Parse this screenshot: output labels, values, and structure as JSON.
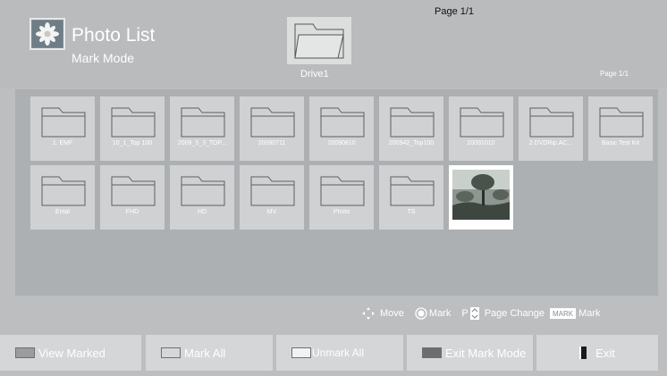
{
  "header": {
    "title": "Photo List",
    "subtitle": "Mark Mode",
    "top_page": "Page 1/1",
    "drive_label": "Drive1",
    "right_page": "Page 1/1"
  },
  "items": [
    {
      "type": "folder",
      "name": "1. EMF"
    },
    {
      "type": "folder",
      "name": "10_1_Top 100"
    },
    {
      "type": "folder",
      "name": "2009_5_3_TOP..."
    },
    {
      "type": "folder",
      "name": "20090711"
    },
    {
      "type": "folder",
      "name": "20090810"
    },
    {
      "type": "folder",
      "name": "200942_Top100"
    },
    {
      "type": "folder",
      "name": "20091010"
    },
    {
      "type": "folder",
      "name": "2.DVDRip.AC..."
    },
    {
      "type": "folder",
      "name": "Basic Test Kit"
    },
    {
      "type": "folder",
      "name": "Ental"
    },
    {
      "type": "folder",
      "name": "FHD"
    },
    {
      "type": "folder",
      "name": "HD"
    },
    {
      "type": "folder",
      "name": "MV"
    },
    {
      "type": "folder",
      "name": "Photo"
    },
    {
      "type": "folder",
      "name": "TS"
    },
    {
      "type": "photo",
      "name": ""
    }
  ],
  "hints": {
    "move": "Move",
    "mark": "Mark",
    "page_key": "P",
    "page_change": "Page Change",
    "mark_badge": "MARK",
    "mark2": "Mark"
  },
  "buttons": {
    "view_marked": "View Marked",
    "mark_all": "Mark All",
    "unmark_all": "Unmark All",
    "exit_mark_mode": "Exit Mark Mode",
    "exit": "Exit"
  },
  "colors": {
    "red_key": "#9a9c9e",
    "green_key": "#d6d7d8",
    "yellow_key": "#f2f2f2",
    "blue_key": "#6b6e70"
  },
  "icons": {
    "app": "photo-list-flower-icon",
    "folder": "folder-icon",
    "move": "four-way-arrow-icon",
    "mark": "ok-button-icon",
    "page": "page-up-down-key-icon",
    "exit": "exit-door-icon"
  }
}
